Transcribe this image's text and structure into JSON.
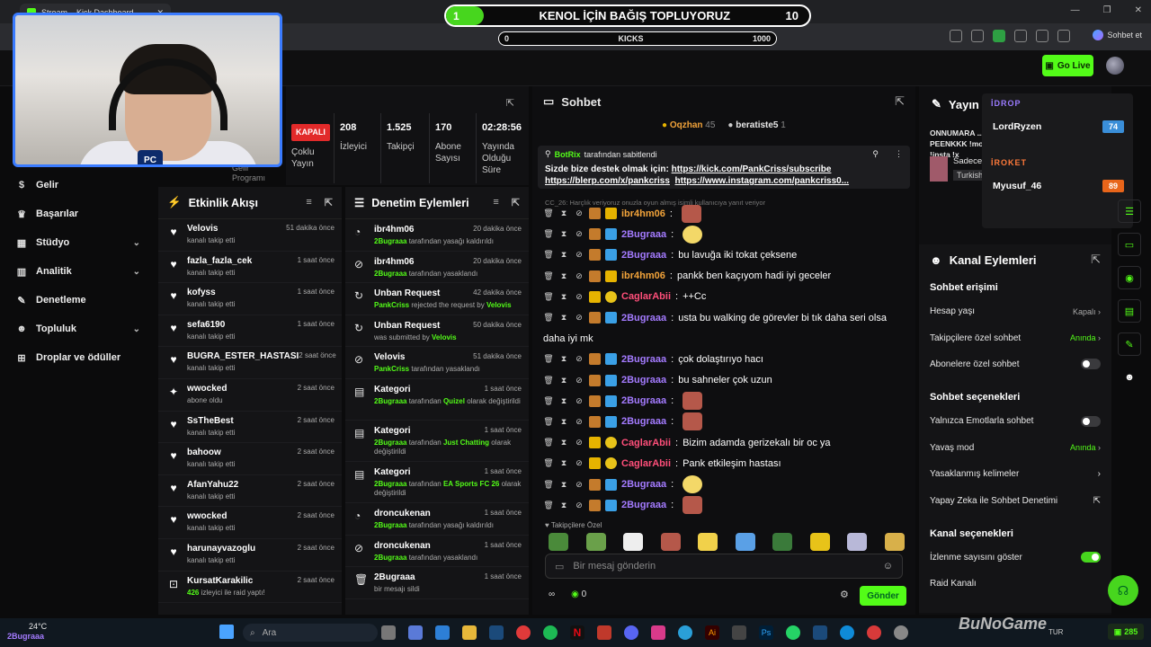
{
  "browser": {
    "tab_title": "Stream – Kick Dashboard",
    "sohbet_label": "Sohbet et"
  },
  "overlay": {
    "donate_left": "1",
    "donate_title": "KENOL İÇİN BAĞIŞ TOPLUYORUZ",
    "donate_right": "10",
    "kicks_left": "0",
    "kicks_label": "KICKS",
    "kicks_right": "1000"
  },
  "header": {
    "go_live": "Go Live"
  },
  "sidebar": {
    "items": [
      {
        "label": "Gelir"
      },
      {
        "label": "Başarılar"
      },
      {
        "label": "Stüdyo"
      },
      {
        "label": "Analitik"
      },
      {
        "label": "Denetleme"
      },
      {
        "label": "Topluluk"
      },
      {
        "label": "Droplar ve ödüller"
      }
    ],
    "partial": "Gelir Programı"
  },
  "stats": {
    "status": "KAPALI",
    "status_sub": "Çoklu Yayın",
    "viewers": "208",
    "viewers_label": "İzleyici",
    "followers": "1.525",
    "followers_label": "Takipçi",
    "subs": "170",
    "subs_label": "Abone Sayısı",
    "duration": "02:28:56",
    "duration_label": "Yayında Olduğu Süre"
  },
  "activity": {
    "title": "Etkinlik Akışı",
    "rows": [
      {
        "name": "Velovis",
        "time": "51 dakika önce",
        "sub": "kanalı takip etti"
      },
      {
        "name": "fazla_fazla_cek",
        "time": "1 saat önce",
        "sub": "kanalı takip etti"
      },
      {
        "name": "kofyss",
        "time": "1 saat önce",
        "sub": "kanalı takip etti"
      },
      {
        "name": "sefa6190",
        "time": "1 saat önce",
        "sub": "kanalı takip etti"
      },
      {
        "name": "BUGRA_ESTER_HASTASI",
        "time": "2 saat önce",
        "sub": "kanalı takip etti"
      },
      {
        "name": "wwocked",
        "time": "2 saat önce",
        "sub": "abone oldu"
      },
      {
        "name": "SsTheBest",
        "time": "2 saat önce",
        "sub": "kanalı takip etti"
      },
      {
        "name": "bahoow",
        "time": "2 saat önce",
        "sub": "kanalı takip etti"
      },
      {
        "name": "AfanYahu22",
        "time": "2 saat önce",
        "sub": "kanalı takip etti"
      },
      {
        "name": "wwocked",
        "time": "2 saat önce",
        "sub": "kanalı takip etti"
      },
      {
        "name": "harunayvazoglu",
        "time": "2 saat önce",
        "sub": "kanalı takip etti"
      },
      {
        "name": "KursatKarakilic",
        "time": "2 saat önce",
        "sub_hl": "426",
        "sub": " izleyici ile raid yaptı!"
      }
    ]
  },
  "audit": {
    "title": "Denetim Eylemleri",
    "rows": [
      {
        "name": "ibr4hm06",
        "time": "20 dakika önce",
        "hl": "2Bugraaa",
        "sub": " tarafından yasağı kaldırıldı"
      },
      {
        "name": "ibr4hm06",
        "time": "20 dakika önce",
        "hl": "2Bugraaa",
        "sub": " tarafından yasaklandı"
      },
      {
        "name": "Unban Request",
        "time": "42 dakika önce",
        "hl": "PankCriss",
        "sub": " rejected the request by ",
        "hl2": "Velovis"
      },
      {
        "name": "Unban Request",
        "time": "50 dakika önce",
        "hl": "",
        "sub": "was submitted by ",
        "hl2": "Velovis"
      },
      {
        "name": "Velovis",
        "time": "51 dakika önce",
        "hl": "PankCriss",
        "sub": " tarafından yasaklandı"
      },
      {
        "name": "Kategori",
        "time": "1 saat önce",
        "hl": "2Bugraaa",
        "sub": " tarafından ",
        "hl2": "Quizel",
        "sub2": " olarak değiştirildi"
      },
      {
        "name": "Kategori",
        "time": "1 saat önce",
        "hl": "2Bugraaa",
        "sub": " tarafından ",
        "hl2": "Just Chatting",
        "sub2": " olarak değiştirildi"
      },
      {
        "name": "Kategori",
        "time": "1 saat önce",
        "hl": "2Bugraaa",
        "sub": " tarafından ",
        "hl2": "EA Sports FC 26",
        "sub2": " olarak değiştirildi"
      },
      {
        "name": "droncukenan",
        "time": "1 saat önce",
        "hl": "2Bugraaa",
        "sub": " tarafından yasağı kaldırıldı"
      },
      {
        "name": "droncukenan",
        "time": "1 saat önce",
        "hl": "2Bugraaa",
        "sub": " tarafından yasaklandı"
      },
      {
        "name": "2Bugraaa",
        "time": "1 saat önce",
        "hl": "",
        "sub": "bir mesajı sildi"
      }
    ]
  },
  "chat": {
    "title": "Sohbet",
    "top_users": [
      {
        "name": "Oqzhan",
        "count": "45"
      },
      {
        "name": "beratiste5",
        "count": "1"
      }
    ],
    "pinned_by": "BotRix",
    "pinned_suffix": "tarafından sabitlendi",
    "pinned_text": "Sizde bize destek olmak için: ",
    "pinned_link1": "https://kick.com/PankCriss/subscribe",
    "pinned_link2": "https://blerp.com/x/pankcriss",
    "pinned_link3": "https://www.instagram.com/pankcriss0...",
    "system_line": "CC_26: Harçlık veriyoruz onuzla oyun almış isimli kullanıcıya yanıt veriyor",
    "messages": [
      {
        "user": "ibr4hm06",
        "color": "orange",
        "text": "",
        "emote": "face"
      },
      {
        "user": "2Bugraaa",
        "color": "purple",
        "text": "",
        "emote": "smiley"
      },
      {
        "user": "2Bugraaa",
        "color": "purple",
        "text": "bu lavuğa iki tokat çeksene"
      },
      {
        "user": "ibr4hm06",
        "color": "orange",
        "text": "pankk ben kaçıyom hadi iyi geceler"
      },
      {
        "user": "CaglarAbii",
        "color": "pink",
        "text": "++Cc"
      },
      {
        "user": "2Bugraaa",
        "color": "purple",
        "text": "usta bu walking de görevler bi tık daha seri olsa",
        "wrap": "daha iyi mk"
      },
      {
        "user": "2Bugraaa",
        "color": "purple",
        "text": "çok dolaştırıyo hacı"
      },
      {
        "user": "2Bugraaa",
        "color": "purple",
        "text": "bu sahneler çok uzun"
      },
      {
        "user": "2Bugraaa",
        "color": "purple",
        "text": "",
        "emote": "face"
      },
      {
        "user": "2Bugraaa",
        "color": "purple",
        "text": "",
        "emote": "face"
      },
      {
        "user": "CaglarAbii",
        "color": "pink",
        "text": "Bizim adamda gerizekalı bir oc ya"
      },
      {
        "user": "CaglarAbii",
        "color": "pink",
        "text": "Pank etkileşim hastası"
      },
      {
        "user": "2Bugraaa",
        "color": "purple",
        "text": "",
        "emote": "smiley"
      },
      {
        "user": "2Bugraaa",
        "color": "purple",
        "text": "",
        "emote": "face"
      }
    ],
    "followers_only": "Takipçilere Özel",
    "placeholder": "Bir mesaj gönderin",
    "footer_count": "0",
    "send": "Gönder"
  },
  "right": {
    "title_partial": "Yayın b",
    "stream_title": "ONNUMARA ... PEENKKK !mobil !insta !x",
    "chat_mode": "Sadece Sohbet",
    "language": "Turkish",
    "overlay_list": {
      "hdr1": "İDROP",
      "row1_name": "LordRyzen",
      "row1_val": "74",
      "hdr2": "İROKET",
      "row2_name": "Myusuf_46",
      "row2_val": "89"
    },
    "actions_title": "Kanal Eylemleri",
    "sec1": "Sohbet erişimi",
    "account_age": "Hesap yaşı",
    "account_age_val": "Kapalı",
    "followers_chat": "Takipçilere özel sohbet",
    "followers_chat_val": "Anında",
    "subs_chat": "Abonelere özel sohbet",
    "sec2": "Sohbet seçenekleri",
    "emote_only": "Yalnızca Emotlarla sohbet",
    "slow_mode": "Yavaş mod",
    "slow_mode_val": "Anında",
    "banned_words": "Yasaklanmış kelimeler",
    "ai_mod": "Yapay Zeka ile Sohbet Denetimi",
    "sec3": "Kanal seçenekleri",
    "show_viewers": "İzlenme sayısını göster",
    "raid": "Raid Kanalı"
  },
  "taskbar": {
    "weather": "24°C",
    "user": "2Bugraaa",
    "search": "Ara",
    "watermark": "BuNoGame",
    "lang": "TUR",
    "kicks_count": "285"
  }
}
